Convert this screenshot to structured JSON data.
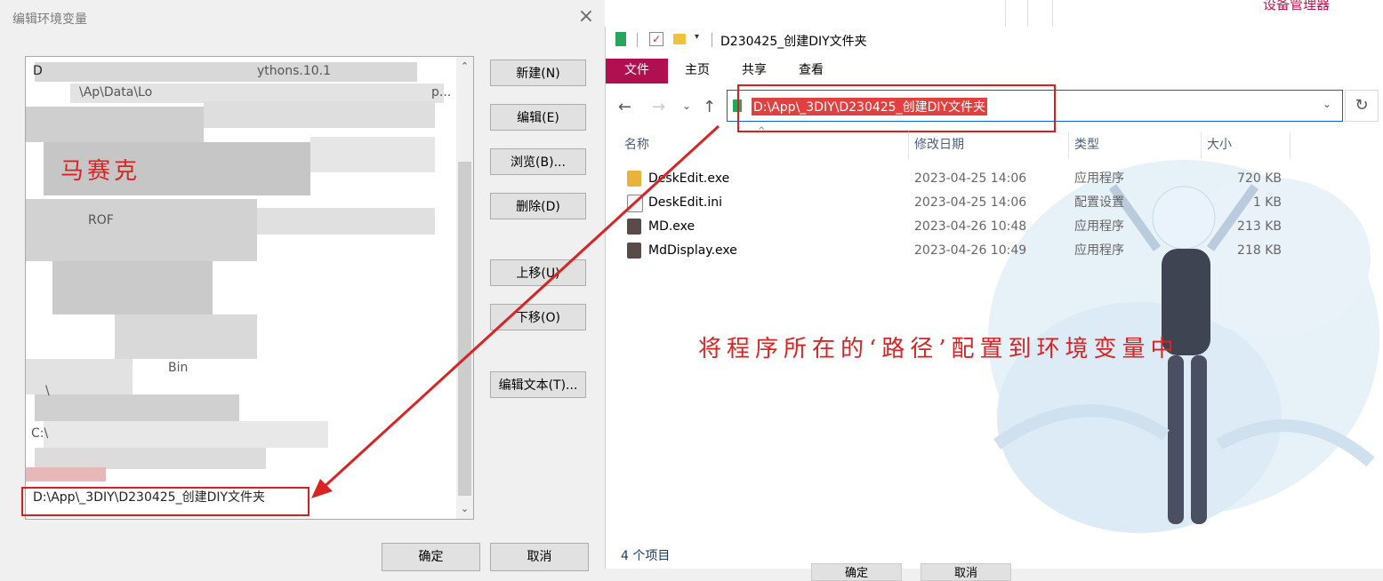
{
  "dialog": {
    "title": "编辑环境变量",
    "close_glyph": "×",
    "mosaic_label": "马赛克",
    "list_rows": [
      {
        "text": "D"
      },
      {
        "text": "ythons.10.1"
      },
      {
        "text": "\\Ap\\Data\\Lo"
      },
      {
        "text": "p..."
      },
      {
        "text": "ROF"
      },
      {
        "text": "Bin"
      },
      {
        "text": "\\"
      },
      {
        "text": "C:\\"
      }
    ],
    "selected_path": "D:\\App\\_3DIY\\D230425_创建DIY文件夹",
    "buttons": {
      "new": "新建(N)",
      "edit": "编辑(E)",
      "browse": "浏览(B)...",
      "delete": "删除(D)",
      "move_up": "上移(U)",
      "move_down": "下移(O)",
      "edit_text": "编辑文本(T)...",
      "ok": "确定",
      "cancel": "取消"
    }
  },
  "explorer": {
    "window_title": "D230425_创建DIY文件夹",
    "ribbon_tabs": [
      "文件",
      "主页",
      "共享",
      "查看"
    ],
    "address_path": "D:\\App\\_3DIY\\D230425_创建DIY文件夹",
    "columns": {
      "name": "名称",
      "modified": "修改日期",
      "type": "类型",
      "size": "大小"
    },
    "files": [
      {
        "name": "DeskEdit.exe",
        "modified": "2023-04-25 14:06",
        "type": "应用程序",
        "size": "720 KB",
        "icon": "app-icon"
      },
      {
        "name": "DeskEdit.ini",
        "modified": "2023-04-25 14:06",
        "type": "配置设置",
        "size": "1 KB",
        "icon": "settings-file-icon"
      },
      {
        "name": "MD.exe",
        "modified": "2023-04-26 10:48",
        "type": "应用程序",
        "size": "213 KB",
        "icon": "app-icon"
      },
      {
        "name": "MdDisplay.exe",
        "modified": "2023-04-26 10:49",
        "type": "应用程序",
        "size": "218 KB",
        "icon": "app-icon"
      }
    ],
    "status": "4 个项目",
    "annotation": "将程序所在的‘路径’配置到环境变量中",
    "top_right_text": "设备管理器",
    "behind_buttons": [
      "确定",
      "取消"
    ]
  },
  "colors": {
    "accent_red": "#d82424",
    "file_tab": "#b01050",
    "address_border": "#0a64c8"
  }
}
